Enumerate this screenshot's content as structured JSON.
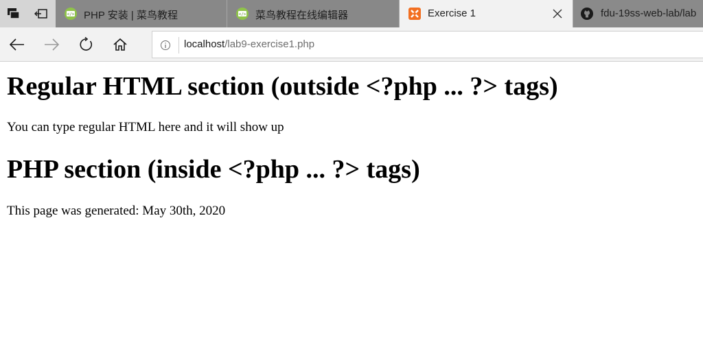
{
  "browser": {
    "tabs": [
      {
        "title": "PHP 安装 | 菜鸟教程",
        "icon": "runoob-favicon-icon",
        "active": false
      },
      {
        "title": "菜鸟教程在线编辑器",
        "icon": "runoob-favicon-icon",
        "active": false
      },
      {
        "title": "Exercise 1",
        "icon": "xampp-favicon-icon",
        "active": true
      },
      {
        "title": "fdu-19ss-web-lab/lab",
        "icon": "github-icon",
        "active": false
      }
    ],
    "address": {
      "host": "localhost",
      "path": "/lab9-exercise1.php"
    },
    "colors": {
      "tabstrip": "#d5d5d5",
      "inactive_tab": "#888888",
      "active_tab": "#f2f2f2",
      "xampp_orange": "#f26f21",
      "runoob_green": "#8fc34a"
    }
  },
  "page": {
    "heading1": "Regular HTML section (outside <?php ... ?> tags)",
    "paragraph1": "You can type regular HTML here and it will show up",
    "heading2": "PHP section (inside <?php ... ?> tags)",
    "paragraph2": "This page was generated: May 30th, 2020"
  }
}
